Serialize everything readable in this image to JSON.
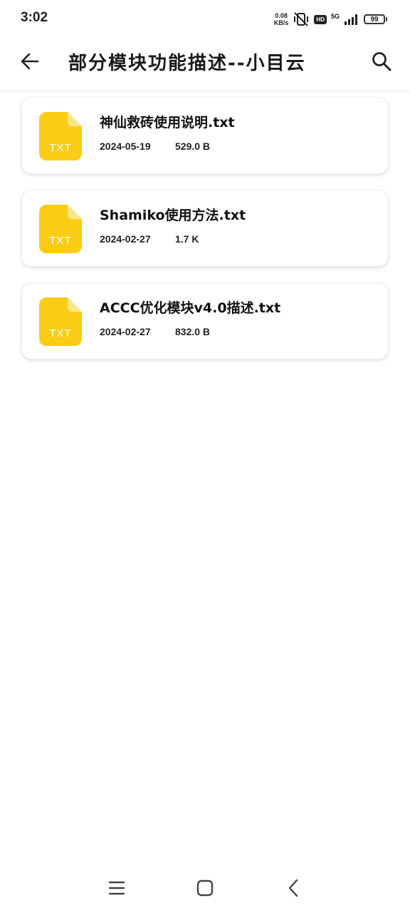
{
  "status": {
    "time": "3:02",
    "net_speed_value": "0.08",
    "net_speed_unit": "KB/s",
    "hd": "HD",
    "network": "5G",
    "battery": "99"
  },
  "appbar": {
    "title": "部分模块功能描述--小目云",
    "back_icon": "arrow-left-icon",
    "search_icon": "search-icon"
  },
  "files": [
    {
      "icon_label": "TXT",
      "name": "神仙救砖使用说明.txt",
      "date": "2024-05-19",
      "size": "529.0 B"
    },
    {
      "icon_label": "TXT",
      "name": "Shamiko使用方法.txt",
      "date": "2024-02-27",
      "size": "1.7 K"
    },
    {
      "icon_label": "TXT",
      "name": "ACCC优化模块v4.0描述.txt",
      "date": "2024-02-27",
      "size": "832.0 B"
    }
  ],
  "colors": {
    "file_icon": "#FACC15",
    "file_icon_fold": "#FDE68A"
  },
  "navbar": {
    "menu_icon": "menu-icon",
    "home_icon": "home-square-icon",
    "back_icon": "back-chevron-icon"
  }
}
